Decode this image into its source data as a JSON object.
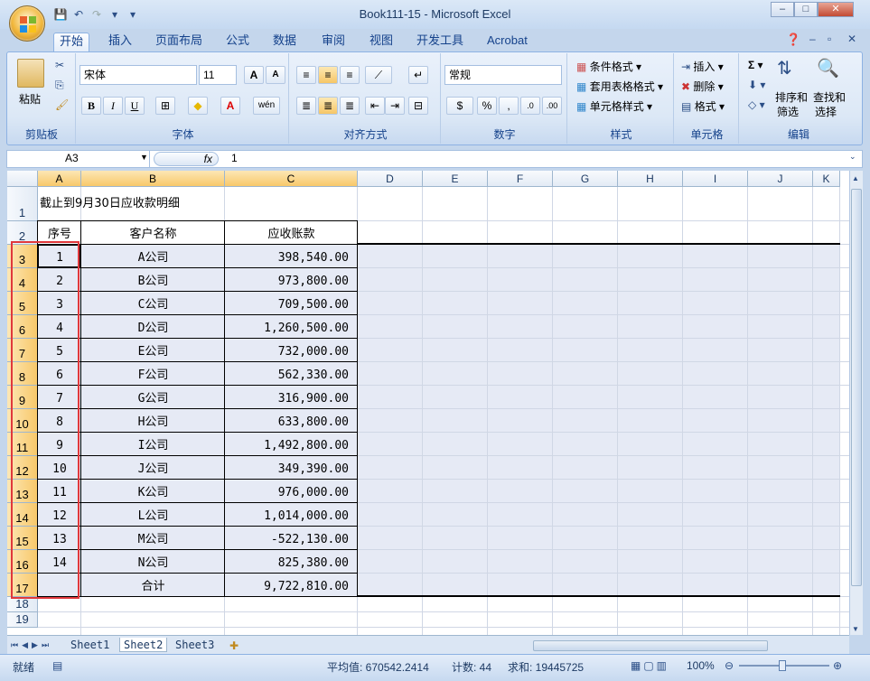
{
  "window": {
    "title": "Book111-15 - Microsoft Excel"
  },
  "tabs": [
    "开始",
    "插入",
    "页面布局",
    "公式",
    "数据",
    "审阅",
    "视图",
    "开发工具",
    "Acrobat"
  ],
  "ribbon": {
    "clipboard": {
      "label": "剪贴板",
      "paste": "粘贴"
    },
    "font": {
      "label": "字体",
      "name": "宋体",
      "size": "11"
    },
    "align": {
      "label": "对齐方式"
    },
    "number": {
      "label": "数字",
      "format": "常规"
    },
    "styles": {
      "label": "样式",
      "cond": "条件格式",
      "table": "套用表格格式",
      "cell": "单元格样式"
    },
    "cells": {
      "label": "单元格",
      "insert": "插入",
      "delete": "删除",
      "format": "格式"
    },
    "edit": {
      "label": "编辑",
      "sort": "排序和",
      "sort2": "筛选",
      "find": "查找和",
      "find2": "选择"
    }
  },
  "formula_bar": {
    "name_box": "A3",
    "fx": "fx",
    "value": "1"
  },
  "columns": [
    "A",
    "B",
    "C",
    "D",
    "E",
    "F",
    "G",
    "H",
    "I",
    "J",
    "K"
  ],
  "rows": [
    "1",
    "2",
    "3",
    "4",
    "5",
    "6",
    "7",
    "8",
    "9",
    "10",
    "11",
    "12",
    "13",
    "14",
    "15",
    "16",
    "17",
    "18",
    "19"
  ],
  "sheet": {
    "title": "截止到9月30日应收款明细",
    "headers": [
      "序号",
      "客户名称",
      "应收账款"
    ],
    "data": [
      [
        "1",
        "A公司",
        "398,540.00"
      ],
      [
        "2",
        "B公司",
        "973,800.00"
      ],
      [
        "3",
        "C公司",
        "709,500.00"
      ],
      [
        "4",
        "D公司",
        "1,260,500.00"
      ],
      [
        "5",
        "E公司",
        "732,000.00"
      ],
      [
        "6",
        "F公司",
        "562,330.00"
      ],
      [
        "7",
        "G公司",
        "316,900.00"
      ],
      [
        "8",
        "H公司",
        "633,800.00"
      ],
      [
        "9",
        "I公司",
        "1,492,800.00"
      ],
      [
        "10",
        "J公司",
        "349,390.00"
      ],
      [
        "11",
        "K公司",
        "976,000.00"
      ],
      [
        "12",
        "L公司",
        "1,014,000.00"
      ],
      [
        "13",
        "M公司",
        "-522,130.00"
      ],
      [
        "14",
        "N公司",
        "825,380.00"
      ]
    ],
    "total_label": "合计",
    "total_value": "9,722,810.00"
  },
  "sheet_tabs": [
    "Sheet1",
    "Sheet2",
    "Sheet3"
  ],
  "status": {
    "ready": "就绪",
    "avg": "平均值: 670542.2414",
    "count": "计数: 44",
    "sum": "求和: 19445725",
    "zoom": "100%"
  },
  "colors": {
    "selection_box": "#e0383b",
    "accent": "#15428b"
  }
}
